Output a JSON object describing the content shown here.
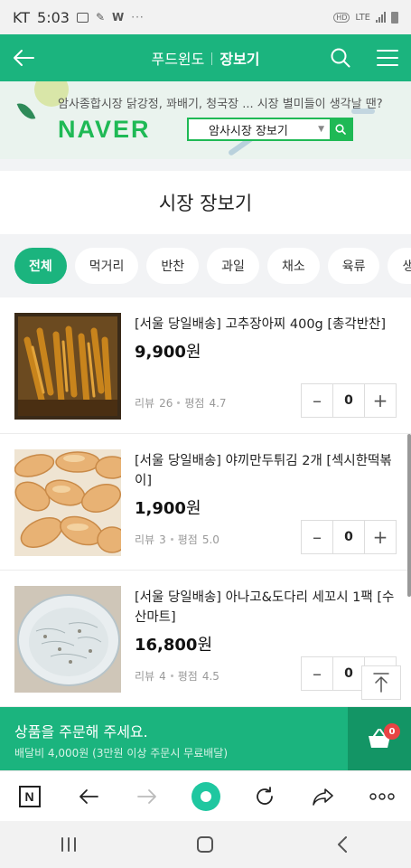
{
  "status_bar": {
    "carrier": "KT",
    "time": "5:03",
    "network": "LTE"
  },
  "header": {
    "back_label": "←",
    "site_name": "푸드윈도",
    "section_name": "장보기"
  },
  "banner": {
    "subtitle": "암사종합시장 닭강정, 꽈배기, 청국장 ... 시장 별미들이 생각날 땐?",
    "logo": "NAVER",
    "search_value": "암사시장 장보기"
  },
  "section_title": "시장 장보기",
  "categories": [
    {
      "label": "전체",
      "active": true
    },
    {
      "label": "먹거리"
    },
    {
      "label": "반찬"
    },
    {
      "label": "과일"
    },
    {
      "label": "채소"
    },
    {
      "label": "육류"
    },
    {
      "label": "생선"
    }
  ],
  "products": [
    {
      "title": "[서울 당일배송] 고추장아찌 400g [총각반찬]",
      "price": "9,900",
      "currency": "원",
      "review_label": "리뷰",
      "review_count": "26",
      "rating_label": "평점",
      "rating": "4.7",
      "qty": "0",
      "image": "pickled-peppers"
    },
    {
      "title": "[서울 당일배송] 야끼만두튀김 2개 [섹시한떡볶이]",
      "price": "1,900",
      "currency": "원",
      "review_label": "리뷰",
      "review_count": "3",
      "rating_label": "평점",
      "rating": "5.0",
      "qty": "0",
      "image": "fried-dumplings"
    },
    {
      "title": "[서울 당일배송] 아나고&도다리 세꼬시 1팩 [수산마트]",
      "price": "16,800",
      "currency": "원",
      "review_label": "리뷰",
      "review_count": "4",
      "rating_label": "평점",
      "rating": "4.5",
      "qty": "0",
      "image": "sliced-fish"
    }
  ],
  "order_bar": {
    "message": "상품을 주문해 주세요.",
    "delivery_fee": "배달비 4,000원 (3만원 이상 주문시 무료배달)",
    "cart_count": "0"
  },
  "browser_toolbar": {
    "naver_button": "N",
    "more": "ooo"
  },
  "colors": {
    "brand_green": "#1bb47e",
    "naver_green": "#1fb955",
    "badge_red": "#e84444"
  }
}
